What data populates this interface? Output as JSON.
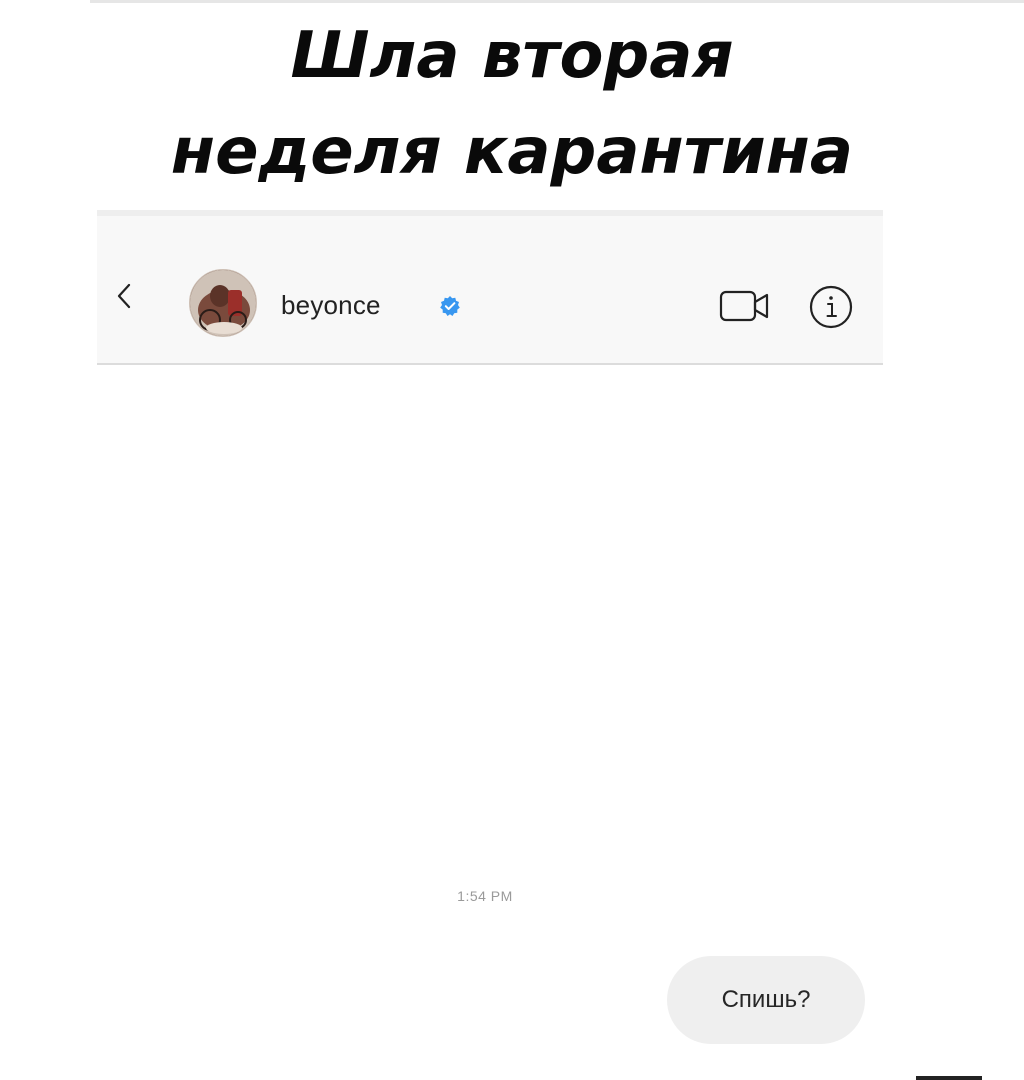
{
  "meme_caption": {
    "line1": "Шла вторая",
    "line2": "неделя карантина"
  },
  "header": {
    "back_icon": "chevron-left-icon",
    "username": "beyonce",
    "verified_icon": "verified-badge-icon",
    "video_icon": "video-call-icon",
    "info_icon": "info-icon"
  },
  "conversation": {
    "timestamp": "1:54 PM",
    "messages": [
      {
        "from": "me",
        "text": "Спишь?"
      }
    ]
  },
  "colors": {
    "verified_blue": "#3897f0",
    "bubble_bg": "#efefef",
    "header_bg": "#f8f8f8"
  }
}
